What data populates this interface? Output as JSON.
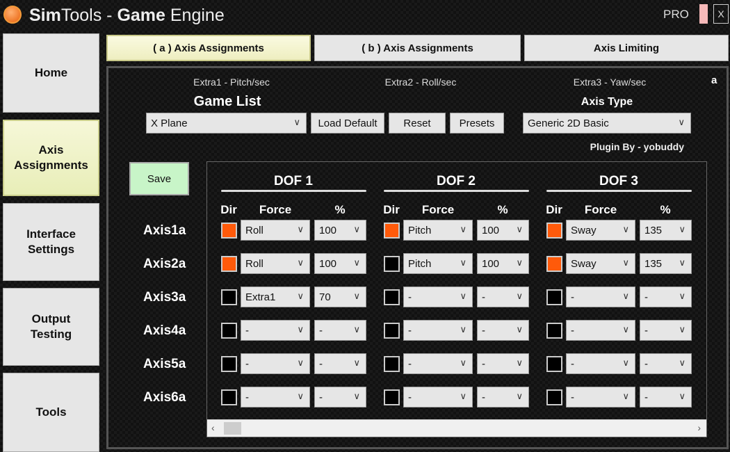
{
  "window": {
    "title_a": "Sim",
    "title_b": "Tools - ",
    "title_c": "Game",
    "title_d": " Engine",
    "pro": "PRO",
    "close": "X"
  },
  "sidebar": [
    {
      "label": "Home"
    },
    {
      "label": "Axis Assignments"
    },
    {
      "label": "Interface Settings"
    },
    {
      "label": "Output Testing"
    },
    {
      "label": "Tools"
    }
  ],
  "tabs": [
    {
      "label": "( a ) Axis Assignments"
    },
    {
      "label": "( b ) Axis Assignments"
    },
    {
      "label": "Axis Limiting"
    }
  ],
  "panel_marker": "a",
  "extras": [
    "Extra1 - Pitch/sec",
    "Extra2 - Roll/sec",
    "Extra3 - Yaw/sec"
  ],
  "game_list": {
    "label": "Game List",
    "value": "X Plane"
  },
  "buttons": {
    "load_default": "Load Default",
    "reset": "Reset",
    "presets": "Presets",
    "save": "Save"
  },
  "axis_type": {
    "label": "Axis Type",
    "value": "Generic 2D Basic"
  },
  "plugin": "Plugin By - yobuddy",
  "dofs": [
    "DOF 1",
    "DOF 2",
    "DOF 3"
  ],
  "columns": {
    "dir": "Dir",
    "force": "Force",
    "pct": "%"
  },
  "colors": {
    "on": "#ff5a0a",
    "off": "#000000"
  },
  "rows": [
    {
      "axis": "Axis1a",
      "cells": [
        {
          "dir": true,
          "force": "Roll",
          "pct": "100"
        },
        {
          "dir": true,
          "force": "Pitch",
          "pct": "100"
        },
        {
          "dir": true,
          "force": "Sway",
          "pct": "135"
        }
      ]
    },
    {
      "axis": "Axis2a",
      "cells": [
        {
          "dir": true,
          "force": "Roll",
          "pct": "100"
        },
        {
          "dir": false,
          "force": "Pitch",
          "pct": "100"
        },
        {
          "dir": true,
          "force": "Sway",
          "pct": "135"
        }
      ]
    },
    {
      "axis": "Axis3a",
      "cells": [
        {
          "dir": false,
          "force": "Extra1",
          "pct": "70"
        },
        {
          "dir": false,
          "force": "-",
          "pct": "-"
        },
        {
          "dir": false,
          "force": "-",
          "pct": "-"
        }
      ]
    },
    {
      "axis": "Axis4a",
      "cells": [
        {
          "dir": false,
          "force": "-",
          "pct": "-"
        },
        {
          "dir": false,
          "force": "-",
          "pct": "-"
        },
        {
          "dir": false,
          "force": "-",
          "pct": "-"
        }
      ]
    },
    {
      "axis": "Axis5a",
      "cells": [
        {
          "dir": false,
          "force": "-",
          "pct": "-"
        },
        {
          "dir": false,
          "force": "-",
          "pct": "-"
        },
        {
          "dir": false,
          "force": "-",
          "pct": "-"
        }
      ]
    },
    {
      "axis": "Axis6a",
      "cells": [
        {
          "dir": false,
          "force": "-",
          "pct": "-"
        },
        {
          "dir": false,
          "force": "-",
          "pct": "-"
        },
        {
          "dir": false,
          "force": "-",
          "pct": "-"
        }
      ]
    }
  ]
}
